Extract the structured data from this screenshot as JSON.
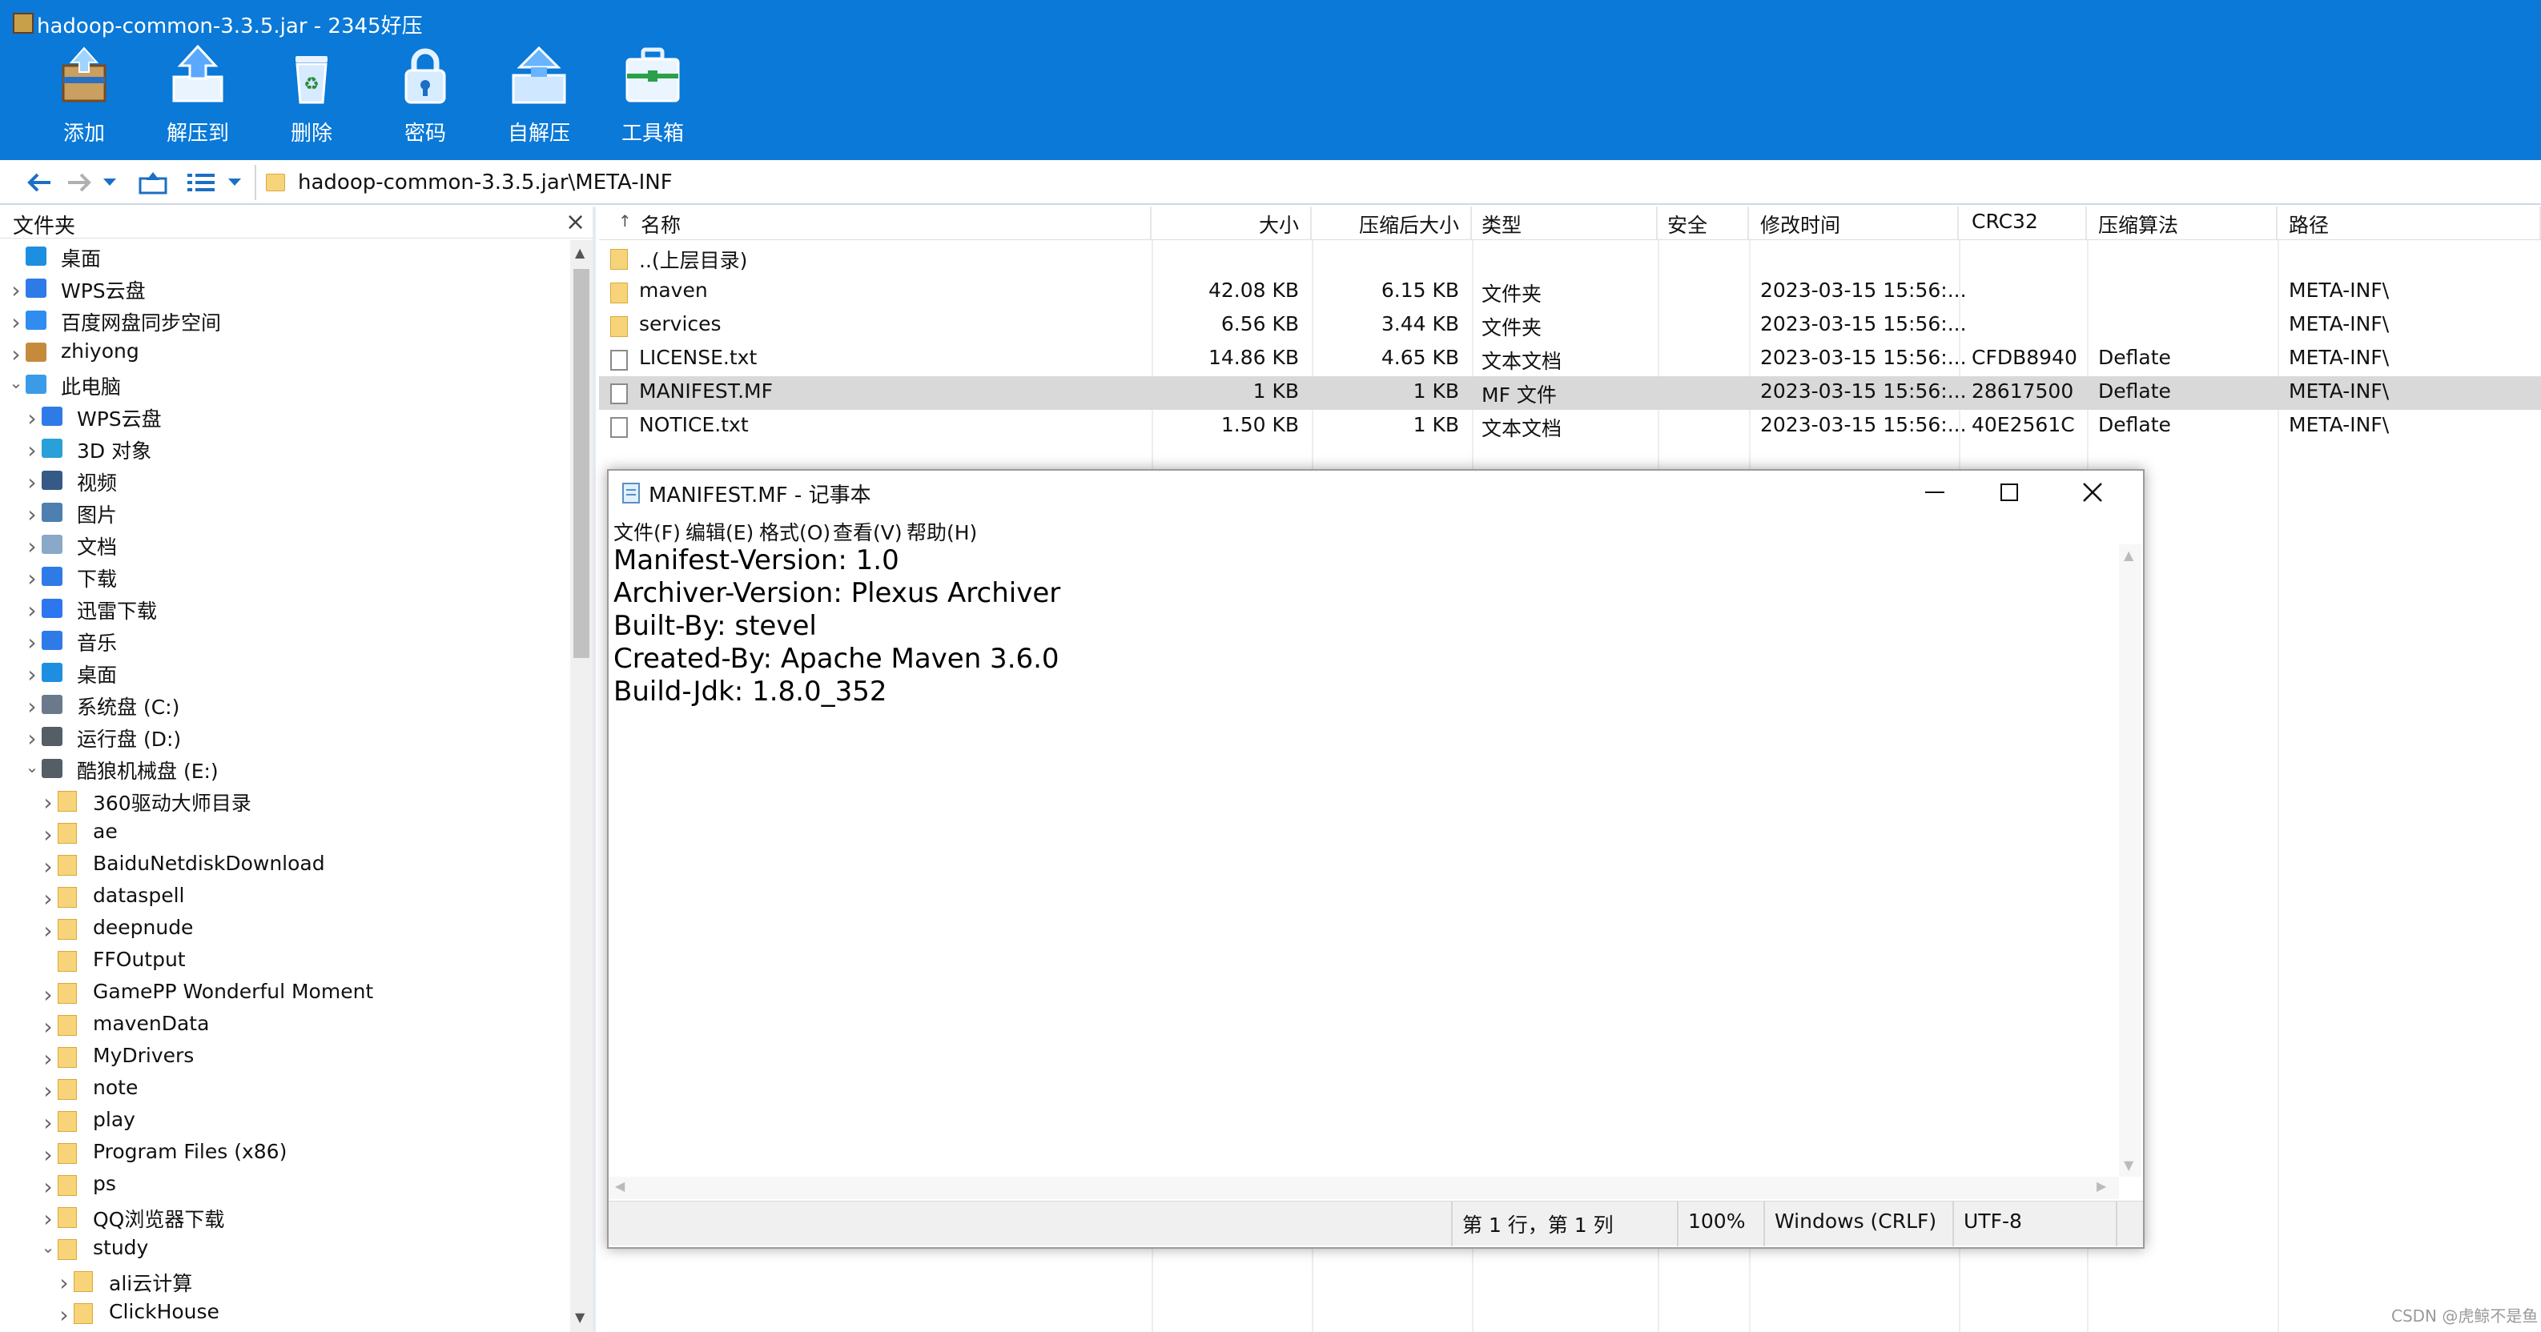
{
  "window_title": "hadoop-common-3.3.5.jar - 2345好压",
  "toolbar": [
    {
      "label": "添加",
      "icon": "add-archive-icon"
    },
    {
      "label": "解压到",
      "icon": "extract-icon"
    },
    {
      "label": "删除",
      "icon": "recycle-bin-icon"
    },
    {
      "label": "密码",
      "icon": "lock-icon"
    },
    {
      "label": "自解压",
      "icon": "self-extract-icon"
    },
    {
      "label": "工具箱",
      "icon": "toolbox-icon"
    }
  ],
  "address_path": "hadoop-common-3.3.5.jar\\META-INF",
  "left_panel": {
    "title": "文件夹",
    "tree": [
      {
        "label": "桌面",
        "level": 0,
        "chev": "",
        "icon": "desktop-icon"
      },
      {
        "label": "WPS云盘",
        "level": 0,
        "chev": ">",
        "icon": "cloud-icon"
      },
      {
        "label": "百度网盘同步空间",
        "level": 0,
        "chev": ">",
        "icon": "baidu-netdisk-icon"
      },
      {
        "label": "zhiyong",
        "level": 0,
        "chev": ">",
        "icon": "user-icon"
      },
      {
        "label": "此电脑",
        "level": 0,
        "chev": "v",
        "icon": "computer-icon"
      },
      {
        "label": "WPS云盘",
        "level": 1,
        "chev": ">",
        "icon": "cloud-icon"
      },
      {
        "label": "3D 对象",
        "level": 1,
        "chev": ">",
        "icon": "3d-objects-icon"
      },
      {
        "label": "视频",
        "level": 1,
        "chev": ">",
        "icon": "video-icon"
      },
      {
        "label": "图片",
        "level": 1,
        "chev": ">",
        "icon": "pictures-icon"
      },
      {
        "label": "文档",
        "level": 1,
        "chev": ">",
        "icon": "documents-icon"
      },
      {
        "label": "下载",
        "level": 1,
        "chev": ">",
        "icon": "download-icon"
      },
      {
        "label": "迅雷下载",
        "level": 1,
        "chev": ">",
        "icon": "xunlei-icon"
      },
      {
        "label": "音乐",
        "level": 1,
        "chev": ">",
        "icon": "music-icon"
      },
      {
        "label": "桌面",
        "level": 1,
        "chev": ">",
        "icon": "desktop-icon"
      },
      {
        "label": "系统盘 (C:)",
        "level": 1,
        "chev": ">",
        "icon": "system-drive-icon"
      },
      {
        "label": "运行盘 (D:)",
        "level": 1,
        "chev": ">",
        "icon": "drive-icon"
      },
      {
        "label": "酷狼机械盘 (E:)",
        "level": 1,
        "chev": "v",
        "icon": "drive-icon"
      },
      {
        "label": "360驱动大师目录",
        "level": 2,
        "chev": ">",
        "icon": "folder-icon"
      },
      {
        "label": "ae",
        "level": 2,
        "chev": ">",
        "icon": "folder-icon"
      },
      {
        "label": "BaiduNetdiskDownload",
        "level": 2,
        "chev": ">",
        "icon": "folder-icon"
      },
      {
        "label": "dataspell",
        "level": 2,
        "chev": ">",
        "icon": "folder-icon"
      },
      {
        "label": "deepnude",
        "level": 2,
        "chev": ">",
        "icon": "folder-icon"
      },
      {
        "label": "FFOutput",
        "level": 2,
        "chev": "",
        "icon": "folder-icon"
      },
      {
        "label": "GamePP Wonderful Moment",
        "level": 2,
        "chev": ">",
        "icon": "folder-icon"
      },
      {
        "label": "mavenData",
        "level": 2,
        "chev": ">",
        "icon": "folder-icon"
      },
      {
        "label": "MyDrivers",
        "level": 2,
        "chev": ">",
        "icon": "folder-icon"
      },
      {
        "label": "note",
        "level": 2,
        "chev": ">",
        "icon": "folder-icon"
      },
      {
        "label": "play",
        "level": 2,
        "chev": ">",
        "icon": "folder-icon"
      },
      {
        "label": "Program Files (x86)",
        "level": 2,
        "chev": ">",
        "icon": "folder-icon"
      },
      {
        "label": "ps",
        "level": 2,
        "chev": ">",
        "icon": "folder-icon"
      },
      {
        "label": "QQ浏览器下载",
        "level": 2,
        "chev": ">",
        "icon": "folder-icon"
      },
      {
        "label": "study",
        "level": 2,
        "chev": "v",
        "icon": "folder-icon"
      },
      {
        "label": "ali云计算",
        "level": 3,
        "chev": ">",
        "icon": "folder-icon"
      },
      {
        "label": "ClickHouse",
        "level": 3,
        "chev": ">",
        "icon": "folder-icon"
      }
    ]
  },
  "file_list": {
    "columns": [
      "名称",
      "大小",
      "压缩后大小",
      "类型",
      "安全",
      "修改时间",
      "CRC32",
      "压缩算法",
      "路径"
    ],
    "sort_indicator": "↑",
    "rows": [
      {
        "name": "..(上层目录)",
        "icon": "folder-icon",
        "size": "",
        "packed": "",
        "type": "",
        "security": "",
        "mtime": "",
        "crc": "",
        "method": "",
        "path": "",
        "selected": false
      },
      {
        "name": "maven",
        "icon": "folder-icon",
        "size": "42.08 KB",
        "packed": "6.15 KB",
        "type": "文件夹",
        "security": "",
        "mtime": "2023-03-15 15:56:...",
        "crc": "",
        "method": "",
        "path": "META-INF\\",
        "selected": false
      },
      {
        "name": "services",
        "icon": "folder-icon",
        "size": "6.56 KB",
        "packed": "3.44 KB",
        "type": "文件夹",
        "security": "",
        "mtime": "2023-03-15 15:56:...",
        "crc": "",
        "method": "",
        "path": "META-INF\\",
        "selected": false
      },
      {
        "name": "LICENSE.txt",
        "icon": "text-file-icon",
        "size": "14.86 KB",
        "packed": "4.65 KB",
        "type": "文本文档",
        "security": "",
        "mtime": "2023-03-15 15:56:...",
        "crc": "CFDB8940",
        "method": "Deflate",
        "path": "META-INF\\",
        "selected": false
      },
      {
        "name": "MANIFEST.MF",
        "icon": "file-icon",
        "size": "1 KB",
        "packed": "1 KB",
        "type": "MF 文件",
        "security": "",
        "mtime": "2023-03-15 15:56:...",
        "crc": "28617500",
        "method": "Deflate",
        "path": "META-INF\\",
        "selected": true
      },
      {
        "name": "NOTICE.txt",
        "icon": "text-file-icon",
        "size": "1.50 KB",
        "packed": "1 KB",
        "type": "文本文档",
        "security": "",
        "mtime": "2023-03-15 15:56:...",
        "crc": "40E2561C",
        "method": "Deflate",
        "path": "META-INF\\",
        "selected": false
      }
    ]
  },
  "notepad": {
    "title": "MANIFEST.MF - 记事本",
    "menu": [
      "文件(F)",
      "编辑(E)",
      "格式(O)",
      "查看(V)",
      "帮助(H)"
    ],
    "content_lines": [
      "Manifest-Version: 1.0",
      "Archiver-Version: Plexus Archiver",
      "Built-By: stevel",
      "Created-By: Apache Maven 3.6.0",
      "Build-Jdk: 1.8.0_352"
    ],
    "status": {
      "position": "第 1 行，第 1 列",
      "zoom": "100%",
      "line_ending": "Windows (CRLF)",
      "encoding": "UTF-8"
    }
  },
  "watermark": "CSDN @虎鲸不是鱼",
  "colors": {
    "header_blue": "#0a79d8",
    "selected_row": "#d9d9d9",
    "folder_yellow": "#f7d47a"
  }
}
